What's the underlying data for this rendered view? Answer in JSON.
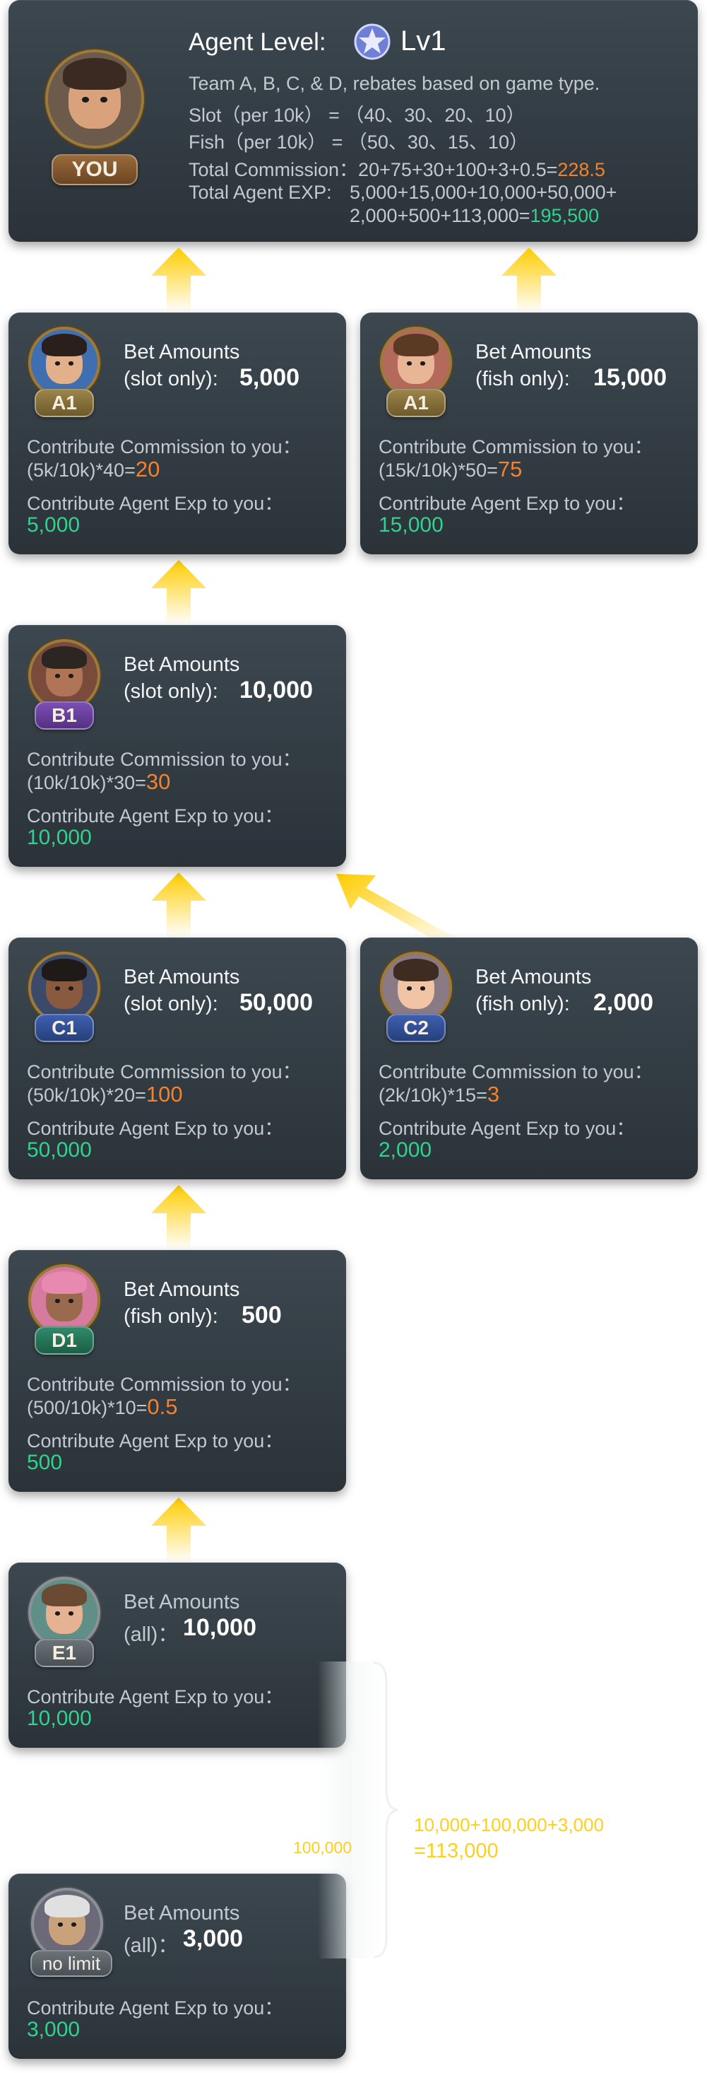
{
  "agent": {
    "level_label": "Agent Level:",
    "level_value": "Lv1",
    "you_badge": "YOU",
    "lines": [
      "Team A, B, C, & D, rebates based on game type.",
      "Slot（per 10k） = （40、30、20、10）",
      "Fish（per 10k） = （50、30、15、10）"
    ],
    "commission_prefix": "Total Commission：20+75+30+100+3+0.5=",
    "commission_total": "228.5",
    "exp_prefix": "Total Agent EXP:",
    "exp_line1": "5,000+15,000+10,000+50,000+",
    "exp_line2_prefix": "2,000+500+113,000=",
    "exp_total": "195,500"
  },
  "cards": {
    "a1_slot": {
      "badge": "A1",
      "bet_title": "Bet Amounts",
      "bet_type": "(slot only):",
      "bet_value": "5,000",
      "comm_label": "Contribute Commission to you：",
      "comm_formula": "(5k/10k)*40=",
      "comm_value": "20",
      "exp_label": "Contribute Agent Exp to you：",
      "exp_value": "5,000"
    },
    "a1_fish": {
      "badge": "A1",
      "bet_title": "Bet Amounts",
      "bet_type": "(fish only):",
      "bet_value": "15,000",
      "comm_label": "Contribute Commission to you：",
      "comm_formula": "(15k/10k)*50=",
      "comm_value": "75",
      "exp_label": "Contribute Agent Exp to you：",
      "exp_value": "15,000"
    },
    "b1": {
      "badge": "B1",
      "bet_title": "Bet Amounts",
      "bet_type": "(slot only):",
      "bet_value": "10,000",
      "comm_label": "Contribute Commission to you：",
      "comm_formula": "(10k/10k)*30=",
      "comm_value": "30",
      "exp_label": "Contribute Agent Exp to you：",
      "exp_value": "10,000"
    },
    "c1": {
      "badge": "C1",
      "bet_title": "Bet Amounts",
      "bet_type": "(slot only):",
      "bet_value": "50,000",
      "comm_label": "Contribute Commission to you：",
      "comm_formula": "(50k/10k)*20=",
      "comm_value": "100",
      "exp_label": "Contribute Agent Exp to you：",
      "exp_value": "50,000"
    },
    "c2": {
      "badge": "C2",
      "bet_title": "Bet Amounts",
      "bet_type": "(fish only):",
      "bet_value": "2,000",
      "comm_label": "Contribute Commission to you：",
      "comm_formula": "(2k/10k)*15=",
      "comm_value": "3",
      "exp_label": "Contribute Agent Exp to you：",
      "exp_value": "2,000"
    },
    "d1": {
      "badge": "D1",
      "bet_title": "Bet Amounts",
      "bet_type": "(fish only):",
      "bet_value": "500",
      "comm_label": "Contribute Commission to you：",
      "comm_formula": "(500/10k)*10=",
      "comm_value": "0.5",
      "exp_label": "Contribute Agent Exp to you：",
      "exp_value": "500"
    },
    "e1": {
      "badge": "E1",
      "bet_title": "Bet Amounts",
      "bet_type": "(all)：",
      "bet_value": "10,000",
      "exp_label": "Contribute Agent Exp to you：",
      "exp_value": "10,000"
    },
    "nolimit": {
      "badge": "no limit",
      "bet_title": "Bet Amounts",
      "bet_type": "(all)：",
      "bet_value": "3,000",
      "exp_label": "Contribute Agent Exp to you：",
      "exp_value": "3,000"
    }
  },
  "summary": {
    "mid_value": "100,000",
    "line1": "10,000+100,000+3,000",
    "line2": "=113,000"
  },
  "colors": {
    "orange": "#f5822a",
    "green": "#2fd38d",
    "gold": "#ffcf1a",
    "card": "#333d44"
  }
}
